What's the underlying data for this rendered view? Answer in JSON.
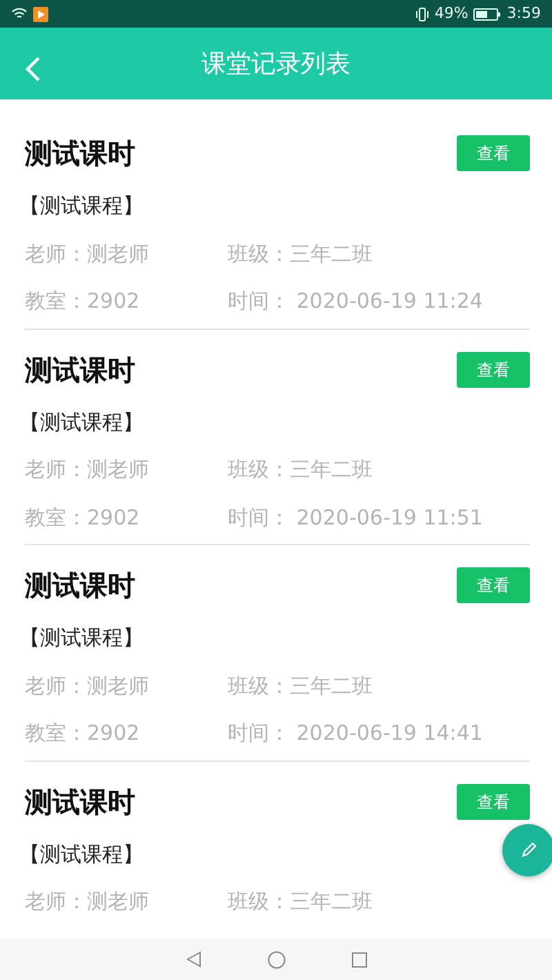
{
  "status_bar": {
    "battery": "49%",
    "time": "3:59"
  },
  "header": {
    "title": "课堂记录列表"
  },
  "records": [
    {
      "title": "测试课时",
      "course": "【测试课程】",
      "button": "查看",
      "details": [
        "老师：测老师",
        "班级：三年二班",
        "教室：2902",
        "时间： 2020-06-19 11:24"
      ]
    },
    {
      "title": "测试课时",
      "course": "【测试课程】",
      "button": "查看",
      "details": [
        "老师：测老师",
        "班级：三年二班",
        "教室：2902",
        "时间： 2020-06-19 11:51"
      ]
    },
    {
      "title": "测试课时",
      "course": "【测试课程】",
      "button": "查看",
      "details": [
        "老师：测老师",
        "班级：三年二班",
        "教室：2902",
        "时间： 2020-06-19 14:41"
      ]
    },
    {
      "title": "测试课时",
      "course": "【测试课程】",
      "button": "查看",
      "details": [
        "老师：测老师",
        "班级：三年二班"
      ]
    }
  ]
}
